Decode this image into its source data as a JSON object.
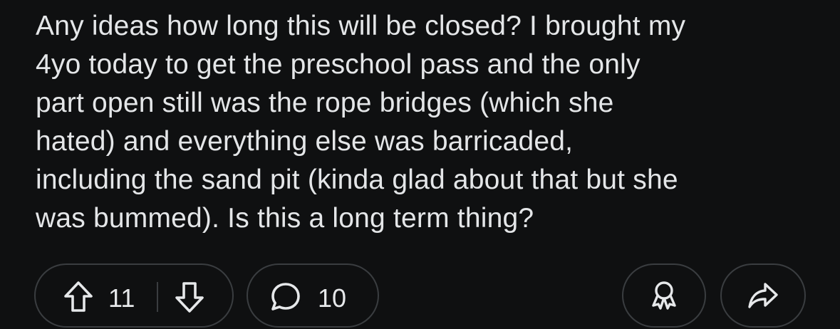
{
  "post": {
    "body_lines": [
      "Any ideas how long this will be closed? I brought my",
      "4yo today to get the preschool pass and the only",
      "part open still was the rope bridges (which she",
      "hated) and everything else was barricaded,",
      "including the sand pit (kinda glad about that but she",
      "was bummed). Is this a long term thing?"
    ]
  },
  "actions": {
    "vote_count": "11",
    "comment_count": "10",
    "icons": {
      "upvote": "upvote-arrow-icon",
      "downvote": "downvote-arrow-icon",
      "comment": "comment-bubble-icon",
      "award": "award-icon",
      "share": "share-arrow-icon"
    }
  },
  "colors": {
    "background": "#0f1011",
    "text": "#e4e6e8",
    "pill_border": "#3a3d40"
  }
}
